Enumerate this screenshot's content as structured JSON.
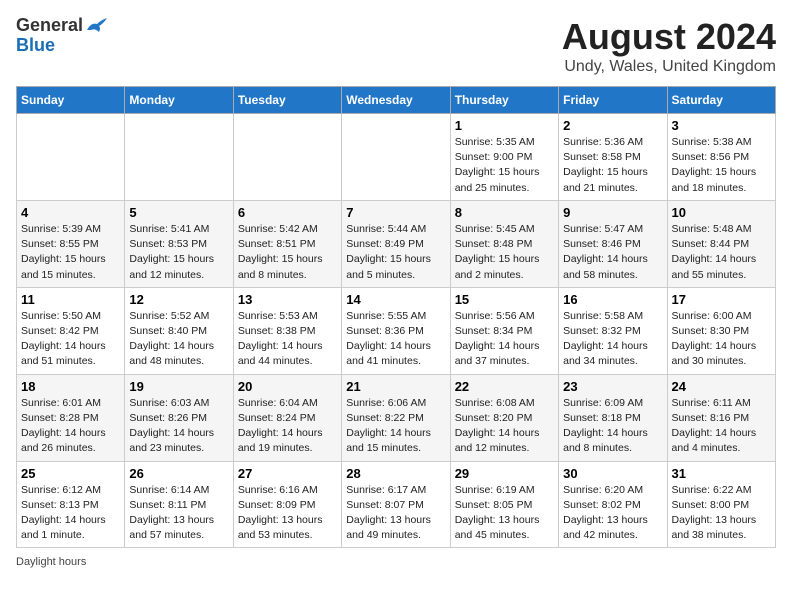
{
  "header": {
    "logo_general": "General",
    "logo_blue": "Blue",
    "title": "August 2024",
    "subtitle": "Undy, Wales, United Kingdom"
  },
  "days_of_week": [
    "Sunday",
    "Monday",
    "Tuesday",
    "Wednesday",
    "Thursday",
    "Friday",
    "Saturday"
  ],
  "weeks": [
    [
      {
        "day": "",
        "sunrise": "",
        "sunset": "",
        "daylight": ""
      },
      {
        "day": "",
        "sunrise": "",
        "sunset": "",
        "daylight": ""
      },
      {
        "day": "",
        "sunrise": "",
        "sunset": "",
        "daylight": ""
      },
      {
        "day": "",
        "sunrise": "",
        "sunset": "",
        "daylight": ""
      },
      {
        "day": "1",
        "sunrise": "5:35 AM",
        "sunset": "9:00 PM",
        "daylight": "15 hours and 25 minutes."
      },
      {
        "day": "2",
        "sunrise": "5:36 AM",
        "sunset": "8:58 PM",
        "daylight": "15 hours and 21 minutes."
      },
      {
        "day": "3",
        "sunrise": "5:38 AM",
        "sunset": "8:56 PM",
        "daylight": "15 hours and 18 minutes."
      }
    ],
    [
      {
        "day": "4",
        "sunrise": "5:39 AM",
        "sunset": "8:55 PM",
        "daylight": "15 hours and 15 minutes."
      },
      {
        "day": "5",
        "sunrise": "5:41 AM",
        "sunset": "8:53 PM",
        "daylight": "15 hours and 12 minutes."
      },
      {
        "day": "6",
        "sunrise": "5:42 AM",
        "sunset": "8:51 PM",
        "daylight": "15 hours and 8 minutes."
      },
      {
        "day": "7",
        "sunrise": "5:44 AM",
        "sunset": "8:49 PM",
        "daylight": "15 hours and 5 minutes."
      },
      {
        "day": "8",
        "sunrise": "5:45 AM",
        "sunset": "8:48 PM",
        "daylight": "15 hours and 2 minutes."
      },
      {
        "day": "9",
        "sunrise": "5:47 AM",
        "sunset": "8:46 PM",
        "daylight": "14 hours and 58 minutes."
      },
      {
        "day": "10",
        "sunrise": "5:48 AM",
        "sunset": "8:44 PM",
        "daylight": "14 hours and 55 minutes."
      }
    ],
    [
      {
        "day": "11",
        "sunrise": "5:50 AM",
        "sunset": "8:42 PM",
        "daylight": "14 hours and 51 minutes."
      },
      {
        "day": "12",
        "sunrise": "5:52 AM",
        "sunset": "8:40 PM",
        "daylight": "14 hours and 48 minutes."
      },
      {
        "day": "13",
        "sunrise": "5:53 AM",
        "sunset": "8:38 PM",
        "daylight": "14 hours and 44 minutes."
      },
      {
        "day": "14",
        "sunrise": "5:55 AM",
        "sunset": "8:36 PM",
        "daylight": "14 hours and 41 minutes."
      },
      {
        "day": "15",
        "sunrise": "5:56 AM",
        "sunset": "8:34 PM",
        "daylight": "14 hours and 37 minutes."
      },
      {
        "day": "16",
        "sunrise": "5:58 AM",
        "sunset": "8:32 PM",
        "daylight": "14 hours and 34 minutes."
      },
      {
        "day": "17",
        "sunrise": "6:00 AM",
        "sunset": "8:30 PM",
        "daylight": "14 hours and 30 minutes."
      }
    ],
    [
      {
        "day": "18",
        "sunrise": "6:01 AM",
        "sunset": "8:28 PM",
        "daylight": "14 hours and 26 minutes."
      },
      {
        "day": "19",
        "sunrise": "6:03 AM",
        "sunset": "8:26 PM",
        "daylight": "14 hours and 23 minutes."
      },
      {
        "day": "20",
        "sunrise": "6:04 AM",
        "sunset": "8:24 PM",
        "daylight": "14 hours and 19 minutes."
      },
      {
        "day": "21",
        "sunrise": "6:06 AM",
        "sunset": "8:22 PM",
        "daylight": "14 hours and 15 minutes."
      },
      {
        "day": "22",
        "sunrise": "6:08 AM",
        "sunset": "8:20 PM",
        "daylight": "14 hours and 12 minutes."
      },
      {
        "day": "23",
        "sunrise": "6:09 AM",
        "sunset": "8:18 PM",
        "daylight": "14 hours and 8 minutes."
      },
      {
        "day": "24",
        "sunrise": "6:11 AM",
        "sunset": "8:16 PM",
        "daylight": "14 hours and 4 minutes."
      }
    ],
    [
      {
        "day": "25",
        "sunrise": "6:12 AM",
        "sunset": "8:13 PM",
        "daylight": "14 hours and 1 minute."
      },
      {
        "day": "26",
        "sunrise": "6:14 AM",
        "sunset": "8:11 PM",
        "daylight": "13 hours and 57 minutes."
      },
      {
        "day": "27",
        "sunrise": "6:16 AM",
        "sunset": "8:09 PM",
        "daylight": "13 hours and 53 minutes."
      },
      {
        "day": "28",
        "sunrise": "6:17 AM",
        "sunset": "8:07 PM",
        "daylight": "13 hours and 49 minutes."
      },
      {
        "day": "29",
        "sunrise": "6:19 AM",
        "sunset": "8:05 PM",
        "daylight": "13 hours and 45 minutes."
      },
      {
        "day": "30",
        "sunrise": "6:20 AM",
        "sunset": "8:02 PM",
        "daylight": "13 hours and 42 minutes."
      },
      {
        "day": "31",
        "sunrise": "6:22 AM",
        "sunset": "8:00 PM",
        "daylight": "13 hours and 38 minutes."
      }
    ]
  ],
  "footer": {
    "daylight_label": "Daylight hours"
  }
}
